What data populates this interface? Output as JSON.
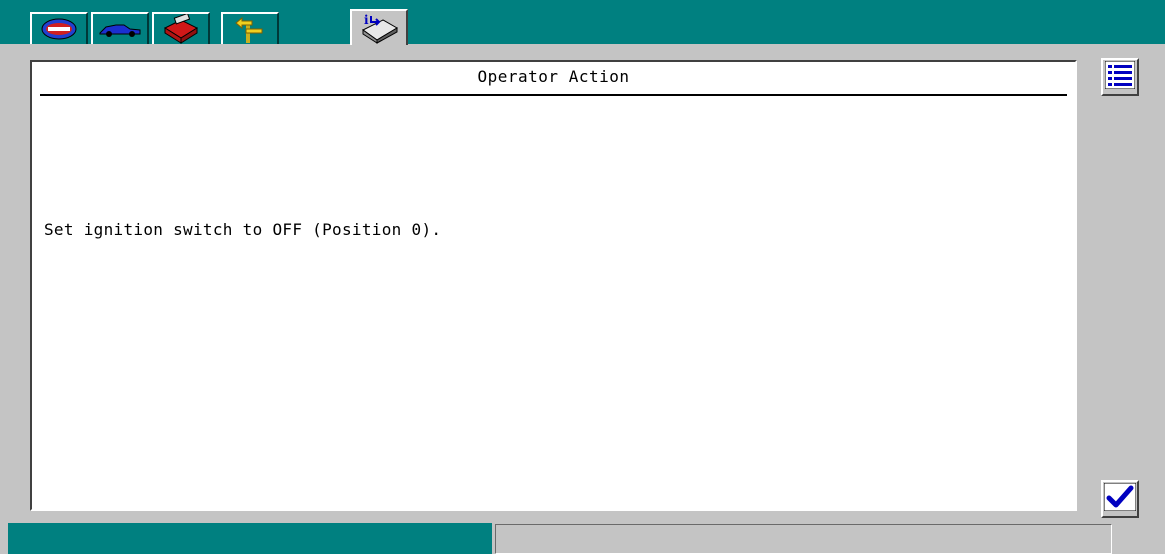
{
  "toolbar": {
    "tabs": [
      {
        "icon": "das-logo-icon"
      },
      {
        "icon": "vehicle-icon"
      },
      {
        "icon": "toolbox-icon"
      },
      {
        "icon": "signpost-icon"
      },
      {
        "icon": "info-book-icon",
        "active": true
      }
    ]
  },
  "panel": {
    "title": "Operator Action",
    "message": "Set ignition switch to OFF (Position 0)."
  },
  "sidebar": {
    "list_icon": "list-icon",
    "confirm_icon": "checkmark-icon"
  },
  "colors": {
    "teal": "#008080",
    "panel_gray": "#c4c4c4",
    "icon_blue": "#0000c0"
  },
  "status": {
    "text": ""
  }
}
